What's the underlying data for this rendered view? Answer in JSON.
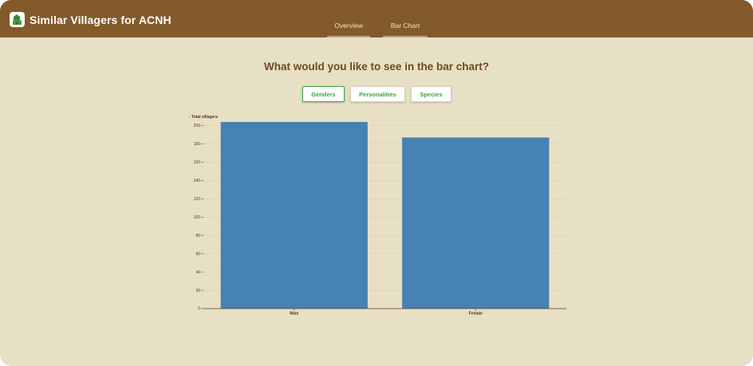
{
  "app": {
    "title": "Similar Villagers for ACNH",
    "logo_icon": "leaf-house-icon"
  },
  "nav": {
    "tabs": [
      {
        "label": "Overview",
        "active": false
      },
      {
        "label": "Bar Chart",
        "active": true
      }
    ]
  },
  "main": {
    "question": "What would you like to see in the bar chart?",
    "options": [
      {
        "label": "Genders",
        "selected": true
      },
      {
        "label": "Personalities",
        "selected": false
      },
      {
        "label": "Species",
        "selected": false
      }
    ]
  },
  "colors": {
    "header": "#835a2a",
    "background": "#e8e0c4",
    "bar": "#4682b4",
    "accent_green": "#3ea33e"
  },
  "chart_data": {
    "type": "bar",
    "ylabel": "↑ Total villagers",
    "categories": [
      "Male",
      "Female"
    ],
    "values": [
      204,
      187
    ],
    "ylim": [
      0,
      200
    ],
    "yticks": [
      0,
      20,
      40,
      60,
      80,
      100,
      120,
      140,
      160,
      180,
      200
    ],
    "grid": true
  }
}
